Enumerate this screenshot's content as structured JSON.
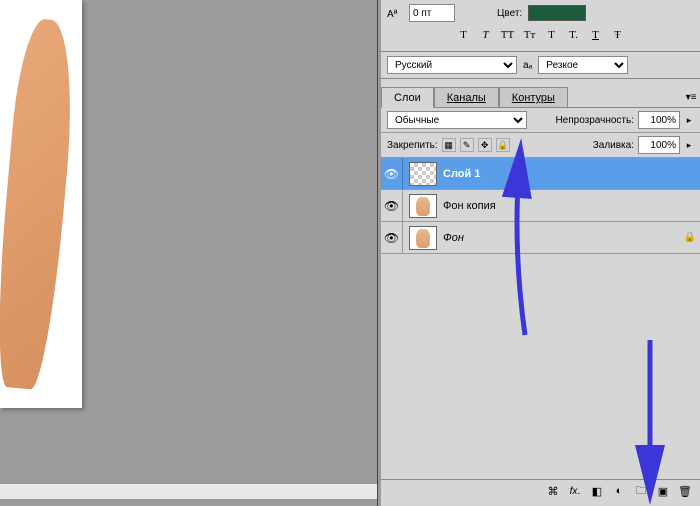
{
  "char_panel": {
    "baseline_value": "0 пт",
    "color_label": "Цвет:",
    "color_hex": "#1a5c3c",
    "type_styles": [
      "T",
      "T",
      "TT",
      "Tт",
      "T",
      "T.",
      "T",
      "Ŧ"
    ]
  },
  "lang_row": {
    "language": "Русский",
    "aa_icon": "aₐ",
    "antialias": "Резкое"
  },
  "tabs": {
    "layers": "Слои",
    "channels": "Каналы",
    "paths": "Контуры"
  },
  "blend_row": {
    "mode": "Обычные",
    "opacity_label": "Непрозрачность:",
    "opacity_value": "100%"
  },
  "lock_row": {
    "label": "Закрепить:",
    "fill_label": "Заливка:",
    "fill_value": "100%"
  },
  "layers": [
    {
      "name": "Слой 1",
      "selected": true,
      "thumb": "checker",
      "locked": false
    },
    {
      "name": "Фон копия",
      "selected": false,
      "thumb": "hand",
      "locked": false
    },
    {
      "name": "Фон",
      "selected": false,
      "thumb": "hand",
      "locked": true,
      "italic": true
    }
  ],
  "footer_icons": [
    "link-icon",
    "fx-icon",
    "mask-icon",
    "adjustment-icon",
    "group-icon",
    "new-layer-icon",
    "trash-icon"
  ]
}
